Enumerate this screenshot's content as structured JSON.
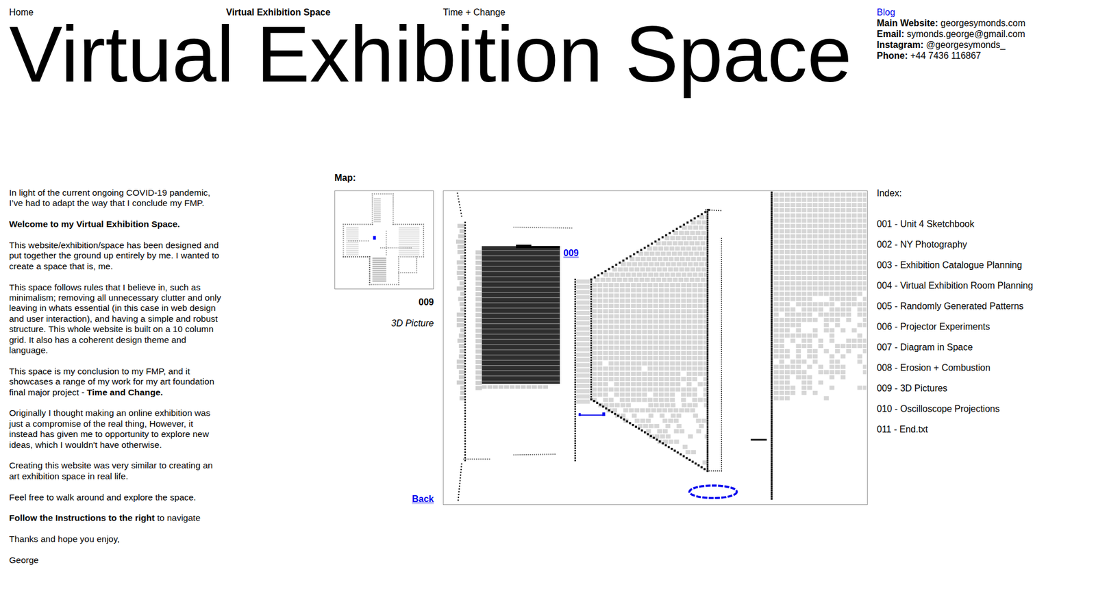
{
  "nav": [
    {
      "label": "Home",
      "selected": false
    },
    {
      "label": "Virtual Exhibition Space",
      "selected": true
    },
    {
      "label": "Time + Change",
      "selected": false
    }
  ],
  "title": "Virtual Exhibition Space",
  "blog": "Blog",
  "contact": [
    {
      "label": "Main Website:",
      "value": "georgesymonds.com"
    },
    {
      "label": "Email:",
      "value": "symonds.george@gmail.com"
    },
    {
      "label": "Instagram:",
      "value": "@georgesymonds_"
    },
    {
      "label": "Phone:",
      "value": "+44 7436 116867"
    }
  ],
  "intro": [
    {
      "runs": [
        {
          "text": "In light of the current ongoing COVID-19 pandemic, I’ve had to adapt the way that I conclude my FMP.",
          "bold": false
        }
      ]
    },
    {
      "runs": [
        {
          "text": "Welcome to my Virtual Exhibition Space.",
          "bold": true
        }
      ]
    },
    {
      "runs": [
        {
          "text": "This website/exhibition/space has been designed and put together the ground up entirely by me. I wanted to create a space that is, me.",
          "bold": false
        }
      ]
    },
    {
      "runs": [
        {
          "text": "This space follows rules that I believe in, such as minimalism; removing all unnecessary clutter and only leaving in whats essential (in this case in web design and user interaction), and having a simple and robust structure. This whole website is built on a 10 column grid. It also has a coherent design theme and language.",
          "bold": false
        }
      ]
    },
    {
      "runs": [
        {
          "text": "This space is my conclusion to my FMP, and it showcases a range of my work for my art foundation final major project - ",
          "bold": false
        },
        {
          "text": "Time and Change.",
          "bold": true
        }
      ]
    },
    {
      "runs": [
        {
          "text": "Originally I thought making an online exhibition was just a compromise of the real thing, However, it instead has given me to opportunity to explore new ideas, which I wouldn't have otherwise.",
          "bold": false
        }
      ]
    },
    {
      "runs": [
        {
          "text": "Creating this website was very similar to creating an art exhibition space in real life.",
          "bold": false
        }
      ]
    },
    {
      "runs": [
        {
          "text": "Feel free to walk around and explore the space.",
          "bold": false
        }
      ]
    },
    {
      "runs": [
        {
          "text": "Follow the Instructions to the right",
          "bold": true
        },
        {
          "text": " to navigate",
          "bold": false
        }
      ]
    },
    {
      "runs": [
        {
          "text": "Thanks and hope you enjoy,",
          "bold": false
        }
      ]
    },
    {
      "runs": [
        {
          "text": "George",
          "bold": false
        }
      ]
    }
  ],
  "map": {
    "label": "Map:",
    "current_number": "009",
    "current_title": "3D Picture",
    "back": "Back",
    "hotspot_label": "009"
  },
  "index": {
    "label": "Index:",
    "items": [
      "001 - Unit 4 Sketchbook",
      "002 - NY Photography",
      "003 - Exhibition Catalogue Planning",
      "004 - Virtual Exhibition Room Planning",
      "005 - Randomly Generated Patterns",
      "006 - Projector Experiments",
      "007 - Diagram in Space",
      "008 - Erosion + Combustion",
      "009 - 3D Pictures",
      "010 - Oscilloscope Projections",
      "011 - End.txt"
    ]
  }
}
